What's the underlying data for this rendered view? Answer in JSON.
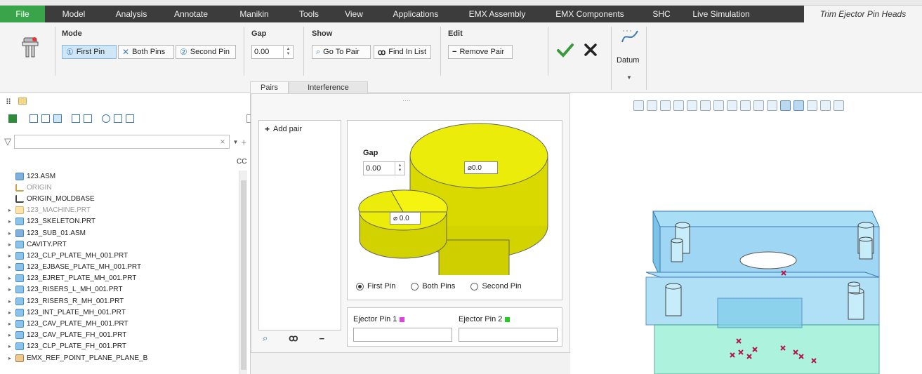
{
  "menubar": {
    "file": "File",
    "items": [
      "Model",
      "Analysis",
      "Annotate",
      "Manikin",
      "Tools",
      "View",
      "Applications",
      "EMX Assembly",
      "EMX Components",
      "SHC",
      "Live Simulation"
    ],
    "active_tab": "Trim Ejector Pin Heads"
  },
  "ribbon": {
    "mode_label": "Mode",
    "first_pin": "First Pin",
    "both_pins": "Both Pins",
    "second_pin": "Second Pin",
    "gap_label": "Gap",
    "gap_value": "0.00",
    "show_label": "Show",
    "go_to_pair": "Go To Pair",
    "find_in_list": "Find In List",
    "edit_label": "Edit",
    "remove_pair": "Remove Pair",
    "datum_label": "Datum",
    "tabs": [
      "Pairs",
      "Interference"
    ]
  },
  "tree": {
    "column_header": "CC",
    "items": [
      {
        "label": "123.ASM",
        "icon": "asm",
        "expand": "",
        "dim": false
      },
      {
        "label": "ORIGIN",
        "icon": "csys",
        "expand": "",
        "dim": true
      },
      {
        "label": "ORIGIN_MOLDBASE",
        "icon": "csys2",
        "expand": "",
        "dim": false
      },
      {
        "label": "123_MACHINE.PRT",
        "icon": "dim",
        "expand": "▸",
        "dim": true
      },
      {
        "label": "123_SKELETON.PRT",
        "icon": "prt",
        "expand": "▸",
        "dim": false
      },
      {
        "label": "123_SUB_01.ASM",
        "icon": "asm",
        "expand": "▸",
        "dim": false
      },
      {
        "label": "CAVITY.PRT",
        "icon": "prt",
        "expand": "▸",
        "dim": false
      },
      {
        "label": "123_CLP_PLATE_MH_001.PRT",
        "icon": "prt",
        "expand": "▸",
        "dim": false
      },
      {
        "label": "123_EJBASE_PLATE_MH_001.PRT",
        "icon": "prt",
        "expand": "▸",
        "dim": false
      },
      {
        "label": "123_EJRET_PLATE_MH_001.PRT",
        "icon": "prt",
        "expand": "▸",
        "dim": false
      },
      {
        "label": "123_RISERS_L_MH_001.PRT",
        "icon": "prt",
        "expand": "▸",
        "dim": false
      },
      {
        "label": "123_RISERS_R_MH_001.PRT",
        "icon": "prt",
        "expand": "▸",
        "dim": false
      },
      {
        "label": "123_INT_PLATE_MH_001.PRT",
        "icon": "prt",
        "expand": "▸",
        "dim": false
      },
      {
        "label": "123_CAV_PLATE_MH_001.PRT",
        "icon": "prt",
        "expand": "▸",
        "dim": false
      },
      {
        "label": "123_CAV_PLATE_FH_001.PRT",
        "icon": "prt",
        "expand": "▸",
        "dim": false
      },
      {
        "label": "123_CLP_PLATE_FH_001.PRT",
        "icon": "prt",
        "expand": "▸",
        "dim": false
      },
      {
        "label": "EMX_REF_POINT_PLANE_PLANE_B",
        "icon": "ref",
        "expand": "▸",
        "dim": false
      }
    ]
  },
  "dialog": {
    "add_pair": "Add pair",
    "gap_label": "Gap",
    "gap_value": "0.00",
    "dia_large": "⌀0.0",
    "dia_small": "⌀ 0.0",
    "radio_first": "First Pin",
    "radio_both": "Both Pins",
    "radio_second": "Second Pin",
    "ejector1": "Ejector Pin 1",
    "ejector2": "Ejector Pin 2"
  },
  "colors": {
    "accent_green": "#3aa44a",
    "pin_yellow": "#e6e600",
    "ejector1": "#e040e0",
    "ejector2": "#22cc22"
  }
}
